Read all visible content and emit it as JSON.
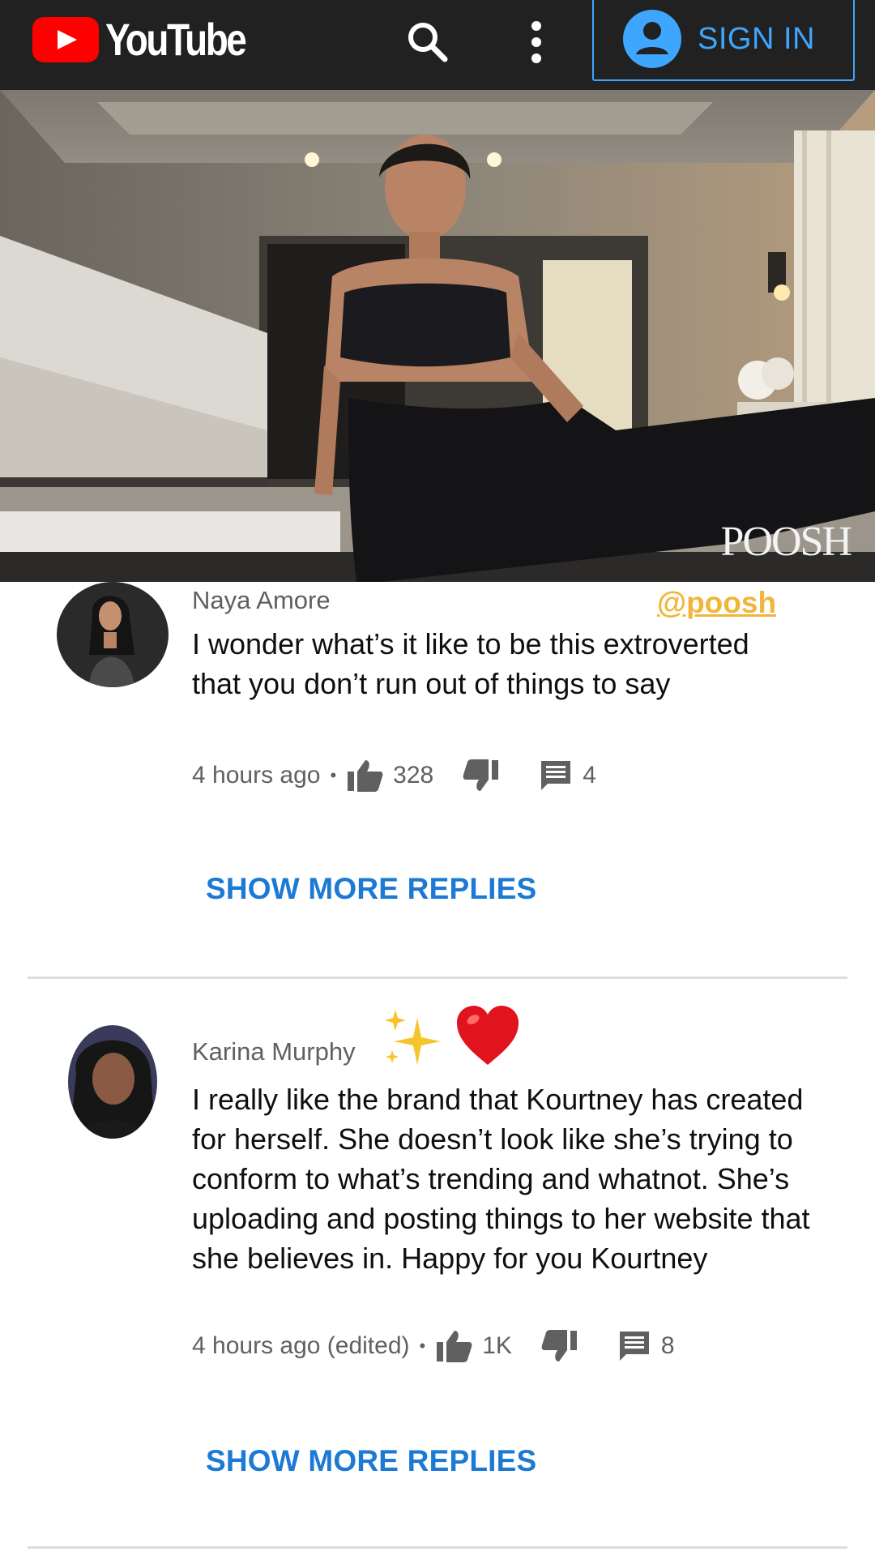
{
  "header": {
    "logo_text": "YouTube",
    "signin_label": "SIGN IN",
    "icons": [
      "youtube-logo-icon",
      "search-icon",
      "more-vert-icon",
      "account-circle-icon"
    ],
    "colors": {
      "bar": "#212121",
      "logo_red": "#ff0000",
      "signin_blue": "#3ea6ff"
    }
  },
  "video": {
    "watermark": "POOSH"
  },
  "overlay_tag": "@poosh",
  "comments": [
    {
      "author": "Naya Amore",
      "text": "I wonder what’s it like to be this extroverted that you don’t run out of things to say",
      "time": "4 hours ago",
      "likes": "328",
      "replies": "4",
      "show_more": "SHOW MORE REPLIES"
    },
    {
      "author": "Karina Murphy",
      "author_emoji": "✨❤️",
      "text": "I really like the brand that Kourtney has created for herself. She doesn’t look like she’s trying to conform to what’s trending and whatnot. She’s uploading and posting things to her website that she believes in. Happy for you Kourtney",
      "time": "4 hours ago (edited)",
      "likes": "1K",
      "replies": "8",
      "show_more": "SHOW MORE REPLIES"
    }
  ],
  "colors": {
    "link_blue": "#1c7ad4",
    "tag_gold": "#f2b53a",
    "meta_grey": "#606060"
  }
}
